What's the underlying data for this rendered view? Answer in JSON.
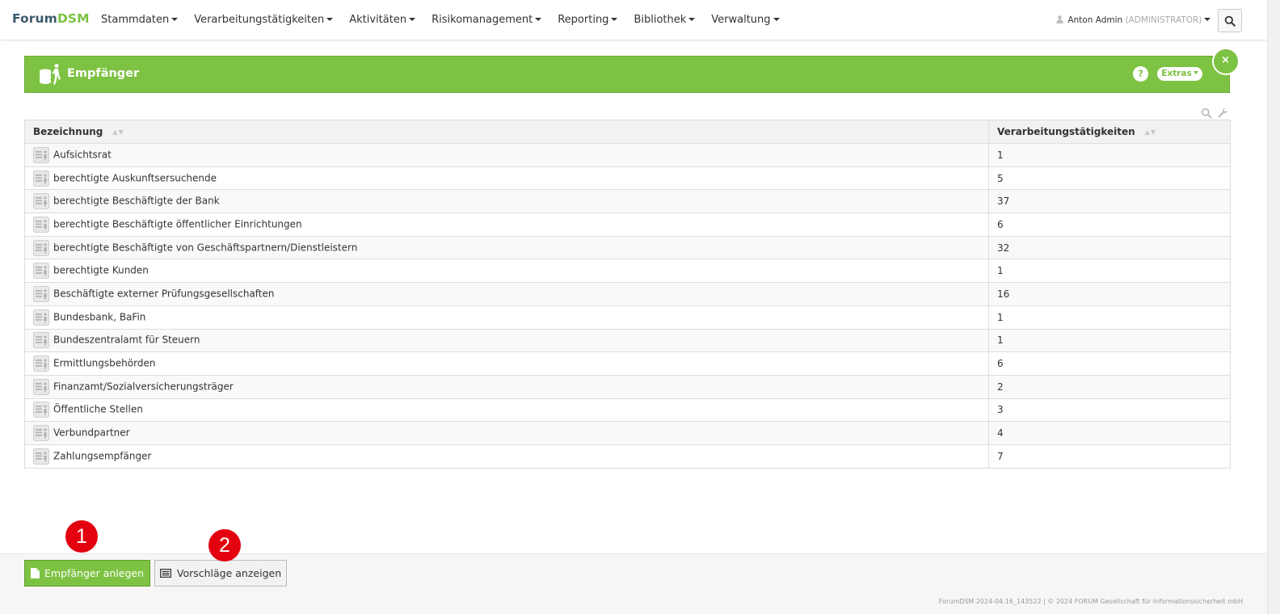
{
  "brand": {
    "part1": "Forum",
    "part2": "DSM"
  },
  "nav": {
    "items": [
      {
        "label": "Stammdaten"
      },
      {
        "label": "Verarbeitungstätigkeiten"
      },
      {
        "label": "Aktivitäten"
      },
      {
        "label": "Risikomanagement"
      },
      {
        "label": "Reporting"
      },
      {
        "label": "Bibliothek"
      },
      {
        "label": "Verwaltung"
      }
    ],
    "user_name": "Anton Admin",
    "user_role": "(ADMINISTRATOR)"
  },
  "panel": {
    "title": "Empfänger",
    "help_label": "?",
    "extras_label": "Extras",
    "close_label": "×"
  },
  "table": {
    "columns": [
      "Bezeichnung",
      "Verarbeitungstätigkeiten"
    ],
    "rows": [
      {
        "name": "Aufsichtsrat",
        "count": "1"
      },
      {
        "name": "berechtigte Auskunftsersuchende",
        "count": "5"
      },
      {
        "name": "berechtigte Beschäftigte der Bank",
        "count": "37"
      },
      {
        "name": "berechtigte Beschäftigte öffentlicher Einrichtungen",
        "count": "6"
      },
      {
        "name": "berechtigte Beschäftigte von Geschäftspartnern/Dienstleistern",
        "count": "32"
      },
      {
        "name": "berechtigte Kunden",
        "count": "1"
      },
      {
        "name": "Beschäftigte externer Prüfungsgesellschaften",
        "count": "16"
      },
      {
        "name": "Bundesbank, BaFin",
        "count": "1"
      },
      {
        "name": "Bundeszentralamt für Steuern",
        "count": "1"
      },
      {
        "name": "Ermittlungsbehörden",
        "count": "6"
      },
      {
        "name": "Finanzamt/Sozialversicherungsträger",
        "count": "2"
      },
      {
        "name": "Öffentliche Stellen",
        "count": "3"
      },
      {
        "name": "Verbundpartner",
        "count": "4"
      },
      {
        "name": "Zahlungsempfänger",
        "count": "7"
      }
    ]
  },
  "actions": {
    "create_label": "Empfänger anlegen",
    "suggest_label": "Vorschläge anzeigen"
  },
  "markers": [
    "1",
    "2"
  ],
  "footer": {
    "version": "ForumDSM 2024-04.16_143522",
    "separator": "|",
    "copyright": "© 2024 FORUM Gesellschaft für Informationssicherheit mbH"
  },
  "colors": {
    "accent": "#7dc242",
    "brand_dark": "#3d5a6b",
    "marker": "#e3000f"
  }
}
